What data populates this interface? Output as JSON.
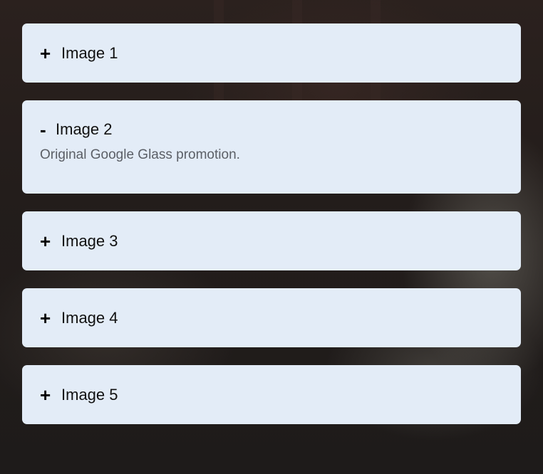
{
  "accordion": {
    "items": [
      {
        "toggle": "+",
        "title": "Image 1",
        "open": false,
        "content": ""
      },
      {
        "toggle": "-",
        "title": "Image 2",
        "open": true,
        "content": "Original Google Glass promotion."
      },
      {
        "toggle": "+",
        "title": "Image 3",
        "open": false,
        "content": ""
      },
      {
        "toggle": "+",
        "title": "Image 4",
        "open": false,
        "content": ""
      },
      {
        "toggle": "+",
        "title": "Image 5",
        "open": false,
        "content": ""
      }
    ]
  },
  "colors": {
    "panel": "#e3ecf7",
    "title_text": "#111111",
    "body_text": "#5b5f66"
  }
}
